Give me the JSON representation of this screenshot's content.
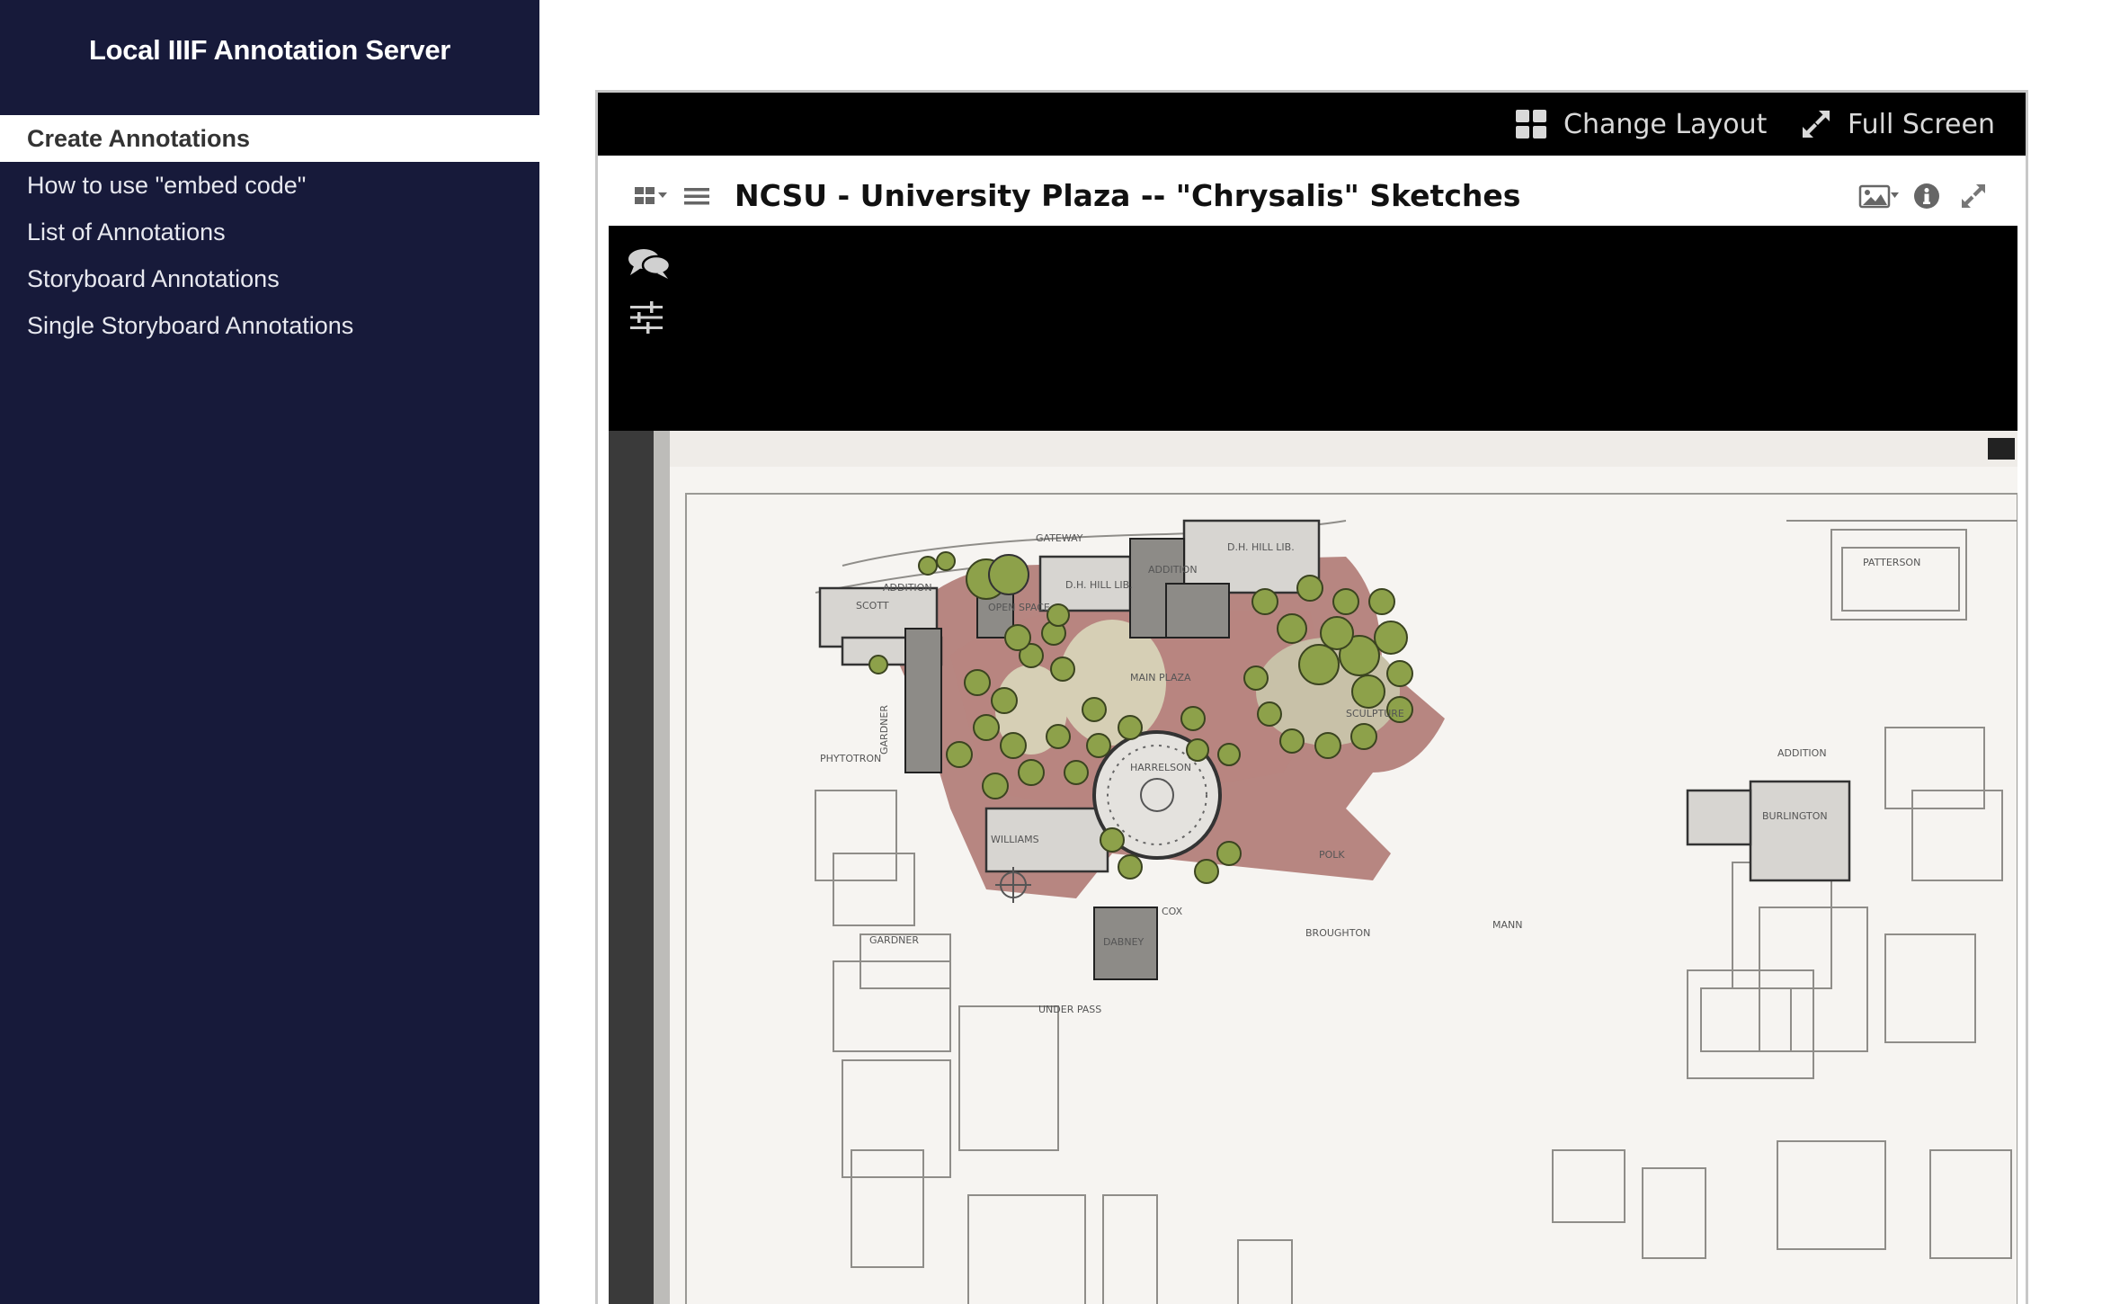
{
  "sidebar": {
    "title": "Local IIIF Annotation Server",
    "items": [
      {
        "label": "Create Annotations",
        "active": true
      },
      {
        "label": "How to use \"embed code\""
      },
      {
        "label": "List of Annotations"
      },
      {
        "label": "Storyboard Annotations"
      },
      {
        "label": "Single Storyboard Annotations"
      }
    ]
  },
  "viewer": {
    "top_bar": {
      "change_layout_label": "Change Layout",
      "full_screen_label": "Full Screen"
    },
    "window": {
      "title": "NCSU - University Plaza -- \"Chrysalis\" Sketches",
      "left_icons": [
        "window-layout-icon",
        "menu-icon"
      ],
      "right_icons": [
        "image-view-icon",
        "info-icon",
        "expand-icon"
      ]
    },
    "canvas_tools": [
      "annotations-comments-icon",
      "image-adjust-icon"
    ],
    "plan_labels": {
      "gateway": "GATEWAY",
      "dh_hill_lib_1": "D.H. HILL LIB.",
      "dh_hill_lib_2": "D.H. HILL LIB.",
      "addition_1": "ADDITION",
      "addition_2": "ADDITION",
      "addition_3": "ADDITION",
      "scott": "SCOTT",
      "open_space": "OPEN SPACE",
      "patterson": "PATTERSON",
      "main_plaza": "MAIN PLAZA",
      "sculpture": "SCULPTURE",
      "phytotron": "PHYTOTRON",
      "gardner_1": "GARDNER",
      "gardner_2": "GARDNER",
      "harrelson": "HARRELSON",
      "williams": "WILLIAMS",
      "burlington": "BURLINGTON",
      "polk": "POLK",
      "cox": "COX",
      "broughton": "BROUGHTON",
      "mann": "MANN",
      "under_pass": "UNDER PASS",
      "dabney": "DABNEY"
    },
    "colors": {
      "sidebar_bg": "#171a3a",
      "plaza_red": "#a86a66",
      "tree_green": "#7f9a3c"
    }
  }
}
